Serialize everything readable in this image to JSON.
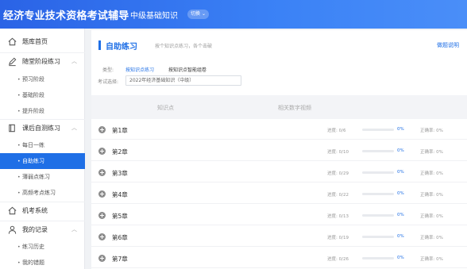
{
  "header": {
    "site_title": "经济专业技术资格考试辅导",
    "level": "中级基础知识",
    "switch_label": "切换"
  },
  "sidebar": {
    "groups": [
      {
        "label": "题库首页",
        "icon": "home-icon",
        "expandable": false,
        "subs": []
      },
      {
        "label": "随堂阶段练习",
        "icon": "pen-icon",
        "expandable": true,
        "subs": [
          "预习阶段",
          "基础阶段",
          "提升阶段"
        ]
      },
      {
        "label": "课后自测练习",
        "icon": "book-icon",
        "expandable": true,
        "subs": [
          "每日一练",
          "自助练习",
          "薄弱点练习",
          "高频考点练习"
        ],
        "active_sub": 1
      },
      {
        "label": "机考系统",
        "icon": "home-icon",
        "expandable": false,
        "subs": []
      },
      {
        "label": "我的记录",
        "icon": "user-icon",
        "expandable": true,
        "subs": [
          "练习历史",
          "我的错题"
        ]
      }
    ]
  },
  "main": {
    "title": "自助练习",
    "subtitle": "按个知识点练习，各个击破",
    "help": "做题说明",
    "type_label": "类型:",
    "type_options": [
      {
        "label": "按知识点练习",
        "selected": true
      },
      {
        "label": "按知识点智能组卷",
        "selected": false
      }
    ],
    "exam_label": "考试选择:",
    "exam_value": "2022年经济基础知识（中级）",
    "columns": [
      "知识点",
      "相关数字视频"
    ],
    "chapters": [
      {
        "name": "第1章",
        "progress_text": "进度: 0/6",
        "progress": 0,
        "pct": "0%",
        "accuracy": "正确率: 0%"
      },
      {
        "name": "第2章",
        "progress_text": "进度: 0/10",
        "progress": 0,
        "pct": "0%",
        "accuracy": "正确率: 0%"
      },
      {
        "name": "第3章",
        "progress_text": "进度: 0/29",
        "progress": 0,
        "pct": "0%",
        "accuracy": "正确率: 0%"
      },
      {
        "name": "第4章",
        "progress_text": "进度: 0/22",
        "progress": 0,
        "pct": "0%",
        "accuracy": "正确率: 0%"
      },
      {
        "name": "第5章",
        "progress_text": "进度: 0/13",
        "progress": 0,
        "pct": "0%",
        "accuracy": "正确率: 0%"
      },
      {
        "name": "第6章",
        "progress_text": "进度: 0/19",
        "progress": 0,
        "pct": "0%",
        "accuracy": "正确率: 0%"
      },
      {
        "name": "第7章",
        "progress_text": "进度: 0/26",
        "progress": 0,
        "pct": "0%",
        "accuracy": "正确率: 0%"
      }
    ]
  },
  "colors": {
    "accent": "#1f6fe6",
    "header_start": "#2a63e6",
    "header_end": "#4a8ef8"
  }
}
